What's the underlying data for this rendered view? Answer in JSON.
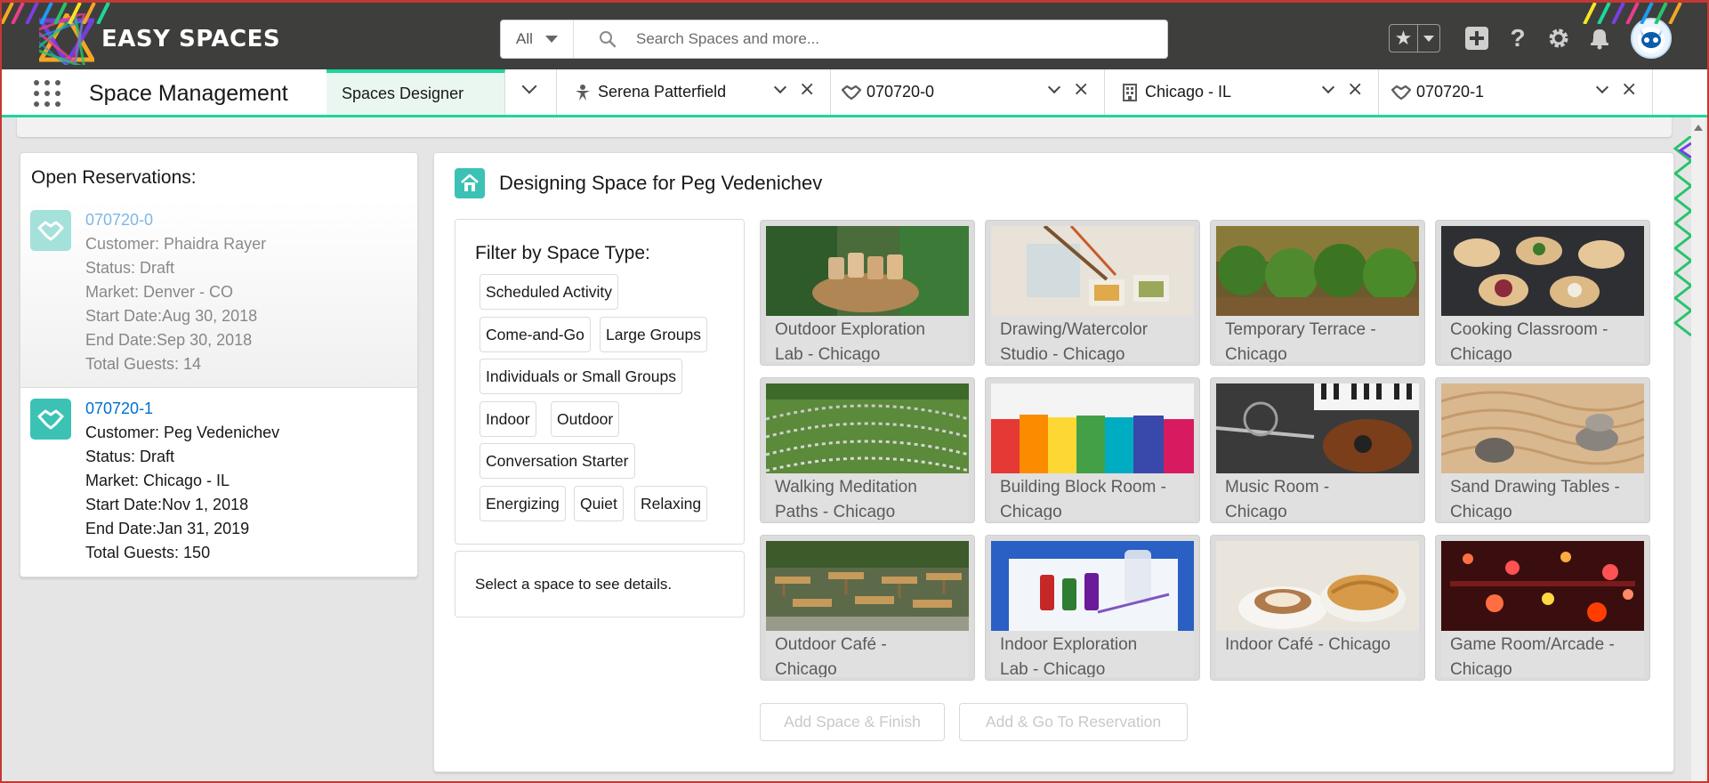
{
  "header": {
    "logo_text": "EASY SPACES",
    "search_scope": "All",
    "search_placeholder": "Search Spaces and more..."
  },
  "nav": {
    "app_name": "Space Management",
    "tabs": [
      {
        "label": "Spaces Designer",
        "icon": "none",
        "active": true
      },
      {
        "label": "Serena Patterfield",
        "icon": "person-icon"
      },
      {
        "label": "070720-0",
        "icon": "handshake-icon"
      },
      {
        "label": "Chicago - IL",
        "icon": "building-icon"
      },
      {
        "label": "070720-1",
        "icon": "handshake-icon"
      }
    ]
  },
  "reservations": {
    "title": "Open Reservations:",
    "items": [
      {
        "id": "070720-0",
        "customer": "Customer: Phaidra Rayer",
        "status": "Status: Draft",
        "market": "Market: Denver - CO",
        "start": "Start Date:Aug 30, 2018",
        "end": "End Date:Sep 30, 2018",
        "guests": "Total Guests: 14"
      },
      {
        "id": "070720-1",
        "customer": "Customer: Peg Vedenichev",
        "status": "Status: Draft",
        "market": "Market: Chicago - IL",
        "start": "Start Date:Nov 1, 2018",
        "end": "End Date:Jan 31, 2019",
        "guests": "Total Guests: 150"
      }
    ]
  },
  "designer": {
    "title": "Designing Space for Peg Vedenichev",
    "filter_title": "Filter by Space Type:",
    "filters": [
      "Scheduled Activity",
      "Come-and-Go",
      "Large Groups",
      "Individuals or Small Groups",
      "Indoor",
      "Outdoor",
      "Conversation Starter",
      "Energizing",
      "Quiet",
      "Relaxing"
    ],
    "details_placeholder": "Select a space to see details.",
    "spaces": [
      {
        "line1": "Outdoor Exploration",
        "line2": "Lab - Chicago"
      },
      {
        "line1": "Drawing/Watercolor",
        "line2": "Studio - Chicago"
      },
      {
        "line1": "Temporary Terrace -",
        "line2": "Chicago"
      },
      {
        "line1": "Cooking Classroom -",
        "line2": "Chicago"
      },
      {
        "line1": "Walking Meditation",
        "line2": "Paths - Chicago"
      },
      {
        "line1": "Building Block Room -",
        "line2": "Chicago"
      },
      {
        "line1": "Music Room -",
        "line2": "Chicago"
      },
      {
        "line1": "Sand Drawing Tables -",
        "line2": "Chicago"
      },
      {
        "line1": "Outdoor Café -",
        "line2": "Chicago"
      },
      {
        "line1": "Indoor Exploration",
        "line2": "Lab - Chicago"
      },
      {
        "line1": "Indoor Café - Chicago",
        "line2": ""
      },
      {
        "line1": "Game Room/Arcade -",
        "line2": "Chicago"
      }
    ],
    "buttons": {
      "add_finish": "Add Space & Finish",
      "add_go": "Add & Go To Reservation"
    }
  },
  "colors": {
    "header_bg": "#3e3e3c",
    "accent_green": "#1cd79b",
    "icon_teal": "#3bc2b4",
    "link_blue": "#0070d2",
    "window_border": "#c23934"
  }
}
